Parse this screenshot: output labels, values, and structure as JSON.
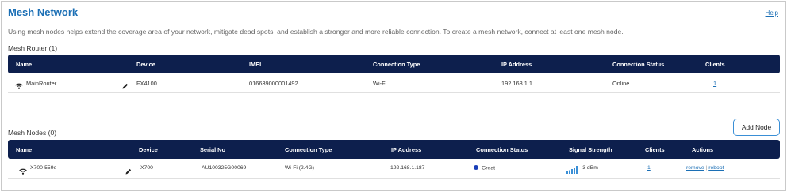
{
  "page": {
    "title": "Mesh Network",
    "help": "Help",
    "description": "Using mesh nodes helps extend the coverage area of your network, mitigate dead spots, and establish a stronger and more reliable connection. To create a mesh network, connect at least one mesh node."
  },
  "router": {
    "section_title": "Mesh Router (1)",
    "columns": [
      "Name",
      "Device",
      "IMEI",
      "Connection Type",
      "IP Address",
      "Connection Status",
      "Clients"
    ],
    "row": {
      "name": "MainRouter",
      "device": "FX4100",
      "imei": "016639000001492",
      "connection_type": "Wi-Fi",
      "ip": "192.168.1.1",
      "status": "Online",
      "clients": "1"
    }
  },
  "nodes": {
    "section_title": "Mesh Nodes (0)",
    "add_button": "Add Node",
    "columns": [
      "Name",
      "Device",
      "Serial No",
      "Connection Type",
      "IP Address",
      "Connection Status",
      "Signal Strength",
      "Clients",
      "Actions"
    ],
    "row": {
      "name": "X700-559e",
      "device": "X700",
      "serial": "AU100325G00069",
      "connection_type": "Wi-Fi (2.4G)",
      "ip": "192.168.1.187",
      "status": "Great",
      "signal": "-3 dBm",
      "clients": "1",
      "remove": "remove",
      "separator": "|",
      "reboot": "reboot"
    }
  },
  "colors": {
    "accent": "#1b6fb5",
    "header_bg": "#0d1f4d",
    "status_dot": "#1a3fb8",
    "signal_bars": "#3a8fd6"
  },
  "icons": {
    "wifi": "wifi-icon",
    "edit": "pencil-icon",
    "signal": "signal-bars-icon"
  }
}
